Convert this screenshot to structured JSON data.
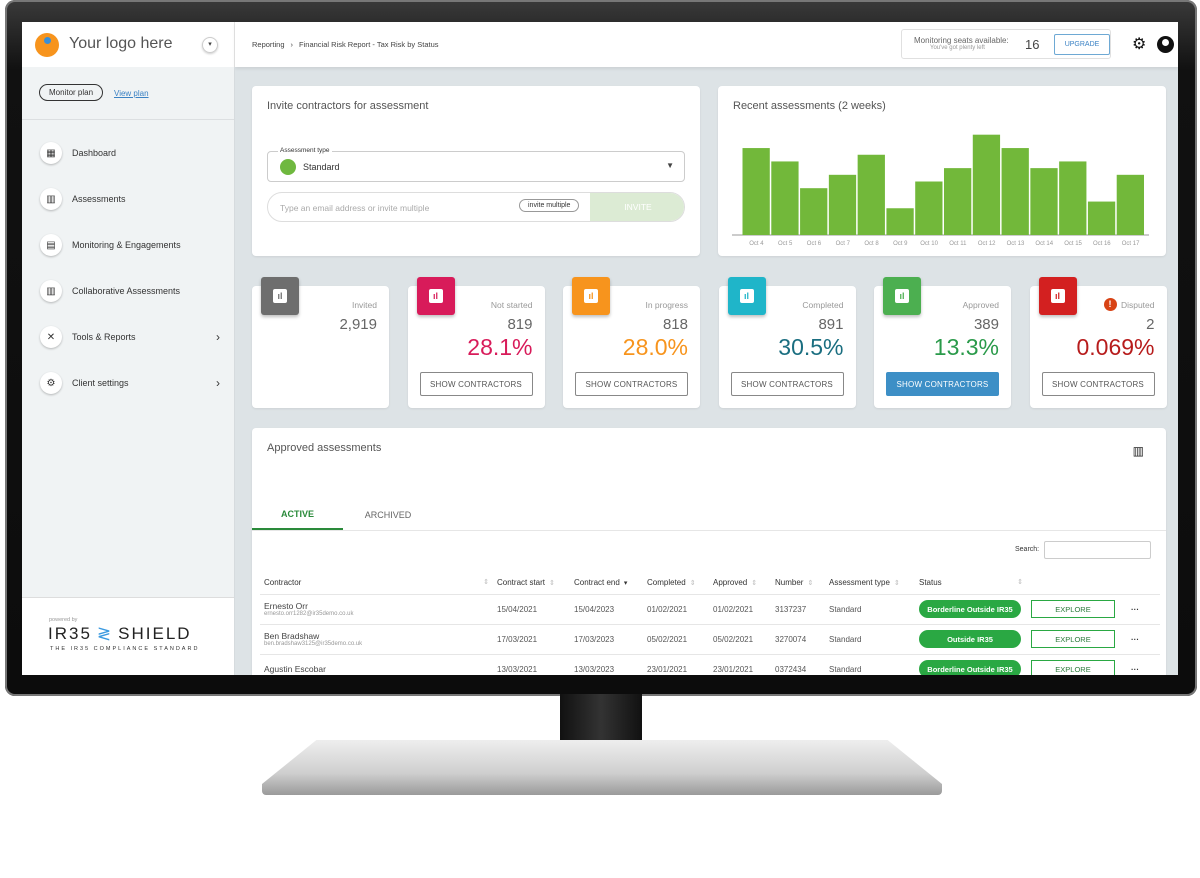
{
  "logo": {
    "text": "Your logo here"
  },
  "breadcrumb": {
    "root": "Reporting",
    "current": "Financial Risk Report - Tax Risk by Status"
  },
  "seats": {
    "label": "Monitoring seats available:",
    "sub": "You've got plenty left",
    "count": "16",
    "upgrade": "UPGRADE"
  },
  "sidebar": {
    "plan": "Monitor plan",
    "view_plan": "View plan",
    "items": [
      {
        "label": "Dashboard",
        "icon": "dashboard-icon"
      },
      {
        "label": "Assessments",
        "icon": "bar-chart-icon"
      },
      {
        "label": "Monitoring & Engagements",
        "icon": "document-icon"
      },
      {
        "label": "Collaborative Assessments",
        "icon": "bar-chart-icon"
      },
      {
        "label": "Tools & Reports",
        "icon": "tools-icon"
      },
      {
        "label": "Client settings",
        "icon": "gear-icon"
      }
    ],
    "powered": "powered by",
    "brand_left": "IR35",
    "brand_right": "SHIELD",
    "brand_tag": "THE IR35 COMPLIANCE STANDARD"
  },
  "invite": {
    "title": "Invite contractors for assessment",
    "type_label": "Assessment type",
    "type_value": "Standard",
    "email_placeholder": "Type an email address or invite multiple",
    "invite_multiple": "invite multiple",
    "invite_button": "INVITE"
  },
  "recent": {
    "title": "Recent assessments (2 weeks)"
  },
  "chart_data": {
    "type": "bar",
    "categories": [
      "Oct 4",
      "Oct 5",
      "Oct 6",
      "Oct 7",
      "Oct 8",
      "Oct 9",
      "Oct 10",
      "Oct 11",
      "Oct 12",
      "Oct 13",
      "Oct 14",
      "Oct 15",
      "Oct 16",
      "Oct 17"
    ],
    "values": [
      13,
      11,
      7,
      9,
      12,
      4,
      8,
      10,
      15,
      13,
      10,
      11,
      5,
      9
    ],
    "ylim": [
      0,
      16
    ],
    "color": "#72b83a",
    "grid": false
  },
  "stats": [
    {
      "label": "Invited",
      "count": "2,919",
      "pct": "",
      "color": "#6e6e6e",
      "button": ""
    },
    {
      "label": "Not started",
      "count": "819",
      "pct": "28.1%",
      "color": "#d81b5a",
      "button": "SHOW CONTRACTORS"
    },
    {
      "label": "In progress",
      "count": "818",
      "pct": "28.0%",
      "color": "#f7941d",
      "button": "SHOW CONTRACTORS"
    },
    {
      "label": "Completed",
      "count": "891",
      "pct": "30.5%",
      "color": "#1fb5c9",
      "pctcolor": "#1a6e80",
      "button": "SHOW CONTRACTORS"
    },
    {
      "label": "Approved",
      "count": "389",
      "pct": "13.3%",
      "color": "#4caf50",
      "pctcolor": "#2a9a4a",
      "button": "SHOW CONTRACTORS"
    },
    {
      "label": "Disputed",
      "count": "2",
      "pct": "0.069%",
      "color": "#d32020",
      "pctcolor": "#b71c1c",
      "button": "SHOW CONTRACTORS"
    }
  ],
  "approved": {
    "title": "Approved assessments",
    "tabs": [
      "ACTIVE",
      "ARCHIVED"
    ],
    "search_label": "Search:",
    "columns": [
      "Contractor",
      "Contract start",
      "Contract end",
      "Completed",
      "Approved",
      "Number",
      "Assessment type",
      "Status"
    ],
    "rows": [
      {
        "name": "Ernesto Orr",
        "email": "ernesto.orr1282@ir35demo.co.uk",
        "start": "15/04/2021",
        "end": "15/04/2023",
        "completed": "01/02/2021",
        "approved": "01/02/2021",
        "number": "3137237",
        "type": "Standard",
        "status": "Borderline Outside IR35",
        "action": "EXPLORE"
      },
      {
        "name": "Ben Bradshaw",
        "email": "ben.bradshaw3125@ir35demo.co.uk",
        "start": "17/03/2021",
        "end": "17/03/2023",
        "completed": "05/02/2021",
        "approved": "05/02/2021",
        "number": "3270074",
        "type": "Standard",
        "status": "Outside IR35",
        "action": "EXPLORE"
      },
      {
        "name": "Agustin Escobar",
        "email": "",
        "start": "13/03/2021",
        "end": "13/03/2023",
        "completed": "23/01/2021",
        "approved": "23/01/2021",
        "number": "0372434",
        "type": "Standard",
        "status": "Borderline Outside IR35",
        "action": "EXPLORE"
      }
    ]
  }
}
